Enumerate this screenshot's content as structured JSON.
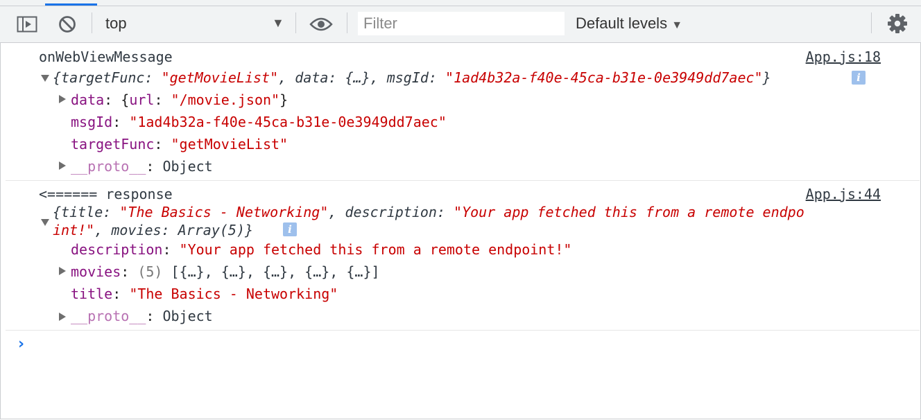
{
  "toolbar": {
    "context": "top",
    "filter_placeholder": "Filter",
    "levels_label": "Default levels"
  },
  "messages": [
    {
      "text": "onWebViewMessage",
      "source": "App.js:18",
      "summary": {
        "open": "{",
        "k1": "targetFunc",
        "v1": "\"getMovieList\"",
        "k2": "data",
        "v2": "{…}",
        "k3": "msgId",
        "v3": "\"1ad4b32a-f40e-45ca-b31e-0e3949dd7aec\"",
        "close": "}"
      },
      "props": [
        {
          "key": "data",
          "colon": ": ",
          "value": "{url: \"/movie.json\"}"
        },
        {
          "key": "msgId",
          "colon": ": ",
          "value": "\"1ad4b32a-f40e-45ca-b31e-0e3949dd7aec\""
        },
        {
          "key": "targetFunc",
          "colon": ": ",
          "value": "\"getMovieList\""
        },
        {
          "key": "__proto__",
          "colon": ": ",
          "value": "Object"
        }
      ]
    },
    {
      "text": "<====== response",
      "source": "App.js:44",
      "summary": {
        "open": "{",
        "k1": "title",
        "v1": "\"The Basics - Networking\"",
        "k2": "description",
        "v2a": "\"Your app fetched this from a remote endpo",
        "v2b": "int!\"",
        "k3": "movies",
        "v3": "Array(5)",
        "close": "}"
      },
      "props": [
        {
          "key": "description",
          "colon": ": ",
          "value": "\"Your app fetched this from a remote endpoint!\""
        },
        {
          "key": "movies",
          "colon": ": ",
          "count": "(5)",
          "value": "[{…}, {…}, {…}, {…}, {…}]"
        },
        {
          "key": "title",
          "colon": ": ",
          "value": "\"The Basics - Networking\""
        },
        {
          "key": "__proto__",
          "colon": ": ",
          "value": "Object"
        }
      ]
    }
  ],
  "prompt": "›",
  "info_glyph": "i",
  "icons": [
    "sidebar-toggle-icon",
    "clear-console-icon",
    "eye-icon",
    "gear-icon",
    "dropdown-arrow-icon",
    "expand-triangle-icon",
    "info-icon"
  ]
}
